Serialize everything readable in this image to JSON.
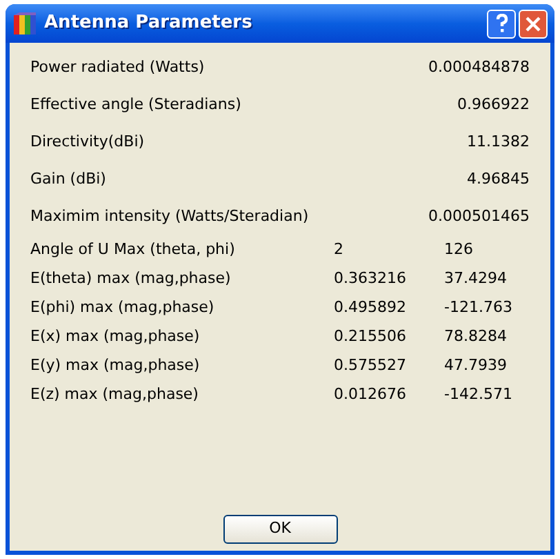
{
  "window": {
    "title": "Antenna Parameters"
  },
  "rows": [
    {
      "kind": "single",
      "label": "Power radiated (Watts)",
      "value": "0.000484878"
    },
    {
      "kind": "single",
      "label": "Effective angle (Steradians)",
      "value": "0.966922"
    },
    {
      "kind": "single",
      "label": "Directivity(dBi)",
      "value": "11.1382"
    },
    {
      "kind": "single",
      "label": "Gain (dBi)",
      "value": "4.96845"
    },
    {
      "kind": "single",
      "label": "Maximim intensity (Watts/Steradian)",
      "value": "0.000501465"
    },
    {
      "kind": "pair",
      "label": "Angle of U Max (theta, phi)",
      "value_1": "2",
      "value_2": "126"
    },
    {
      "kind": "pair",
      "label": "E(theta) max (mag,phase)",
      "value_1": "0.363216",
      "value_2": "37.4294"
    },
    {
      "kind": "pair",
      "label": "E(phi) max (mag,phase)",
      "value_1": "0.495892",
      "value_2": "-121.763"
    },
    {
      "kind": "pair",
      "label": "E(x) max (mag,phase)",
      "value_1": "0.215506",
      "value_2": "78.8284"
    },
    {
      "kind": "pair",
      "label": "E(y) max (mag,phase)",
      "value_1": "0.575527",
      "value_2": "47.7939"
    },
    {
      "kind": "pair",
      "label": "E(z) max (mag,phase)",
      "value_1": "0.012676",
      "value_2": "-142.571"
    }
  ],
  "buttons": [
    {
      "label": "OK"
    }
  ]
}
